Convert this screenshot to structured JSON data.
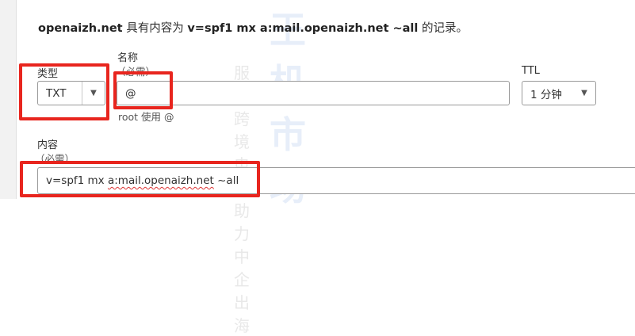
{
  "message": {
    "domain": "openaizh.net",
    "mid": " 具有内容为 ",
    "value": "v=spf1 mx a:mail.openaizh.net ~all",
    "tail": " 的记录。"
  },
  "type_field": {
    "label": "类型",
    "value": "TXT"
  },
  "name_field": {
    "label": "名称",
    "required": "（必需）",
    "value": "@",
    "hint": "root 使用 @"
  },
  "ttl_field": {
    "label": "TTL",
    "value": "1 分钟"
  },
  "content_field": {
    "label": "内容",
    "required": "（必需）",
    "value_prefix": "v=spf1 mx ",
    "value_underlined": "a:mail.openaizh.net",
    "value_suffix": " ~all"
  },
  "watermark": {
    "main": "王 机 市 场",
    "sub": "服务跨境电商 助力中企出海"
  },
  "colors": {
    "highlight": "#e8251e",
    "border": "#9a9a9a",
    "text": "#313131"
  }
}
